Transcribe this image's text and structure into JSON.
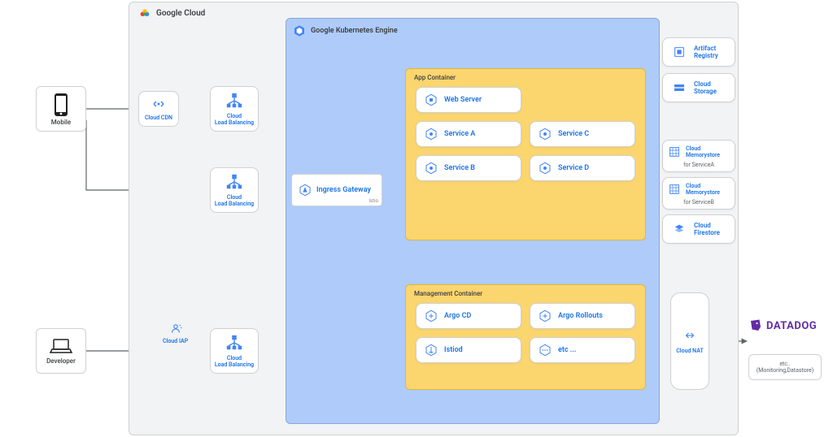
{
  "gcloud": {
    "title": "Google Cloud"
  },
  "gke": {
    "title": "Google Kubernetes Engine"
  },
  "actors": {
    "mobile": "Mobile",
    "developer": "Developer"
  },
  "nodes": {
    "cdn": "Cloud CDN",
    "lb1": "Cloud\nLoad Balancing",
    "lb2": "Cloud\nLoad Balancing",
    "lb3": "Cloud\nLoad Balancing",
    "iap": "Cloud IAP",
    "ingress": {
      "label": "Ingress Gateway",
      "sub": "Istio"
    },
    "cloudnat": "Cloud NAT"
  },
  "containers": {
    "app": {
      "title": "App Container",
      "web": "Web Server",
      "a": "Service A",
      "b": "Service B",
      "c": "Service C",
      "d": "Service D"
    },
    "mgmt": {
      "title": "Management Container",
      "argocd": "Argo CD",
      "argorollouts": "Argo Rollouts",
      "istiod": "Istiod",
      "etc": "etc ..."
    }
  },
  "side": {
    "artifact": "Artifact Registry",
    "storage": "Cloud Storage",
    "mem_a": {
      "label": "Cloud Memorystore",
      "sub": "for ServiceA"
    },
    "mem_b": {
      "label": "Cloud Memorystore",
      "sub": "for ServiceB"
    },
    "firestore": "Cloud Firestore"
  },
  "external": {
    "datadog": "DATADOG",
    "etc": "etc..\n(Monitoring,Datastore)"
  }
}
